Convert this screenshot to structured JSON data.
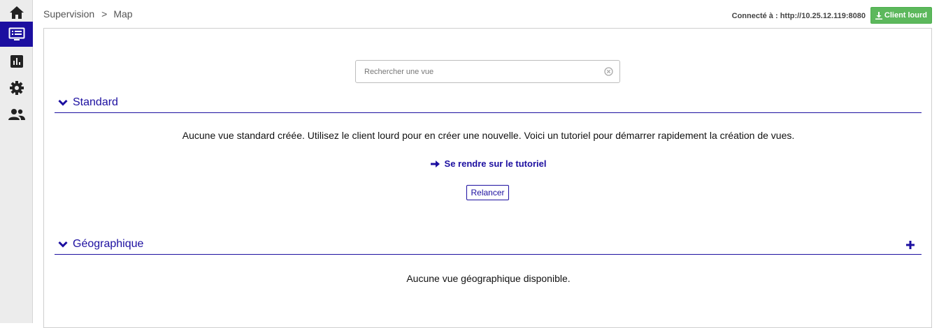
{
  "sidebar": {
    "items": [
      {
        "name": "home",
        "icon": "home-icon"
      },
      {
        "name": "supervision",
        "icon": "monitor-list-icon",
        "active": true
      },
      {
        "name": "reports",
        "icon": "bar-chart-icon"
      },
      {
        "name": "settings",
        "icon": "gear-icon"
      },
      {
        "name": "users",
        "icon": "users-icon"
      }
    ],
    "active_color": "#1c0fa0"
  },
  "header": {
    "breadcrumb": [
      "Supervision",
      "Map"
    ],
    "breadcrumb_separator": ">",
    "connected": "Connecté à : http://10.25.12.119:8080",
    "client_button": "Client lourd",
    "client_button_color": "#5cb85c"
  },
  "search": {
    "placeholder": "Rechercher une vue",
    "value": ""
  },
  "sections": {
    "standard": {
      "title": "Standard",
      "empty_message": "Aucune vue standard créée. Utilisez le client lourd pour en créer une nouvelle. Voici un tutoriel pour démarrer rapidement la création de vues.",
      "tutorial_link": "Se rendre sur le tutoriel",
      "reload_button": "Relancer"
    },
    "geographic": {
      "title": "Géographique",
      "empty_message": "Aucune vue géographique disponible."
    }
  },
  "accent_color": "#1c0fa0"
}
